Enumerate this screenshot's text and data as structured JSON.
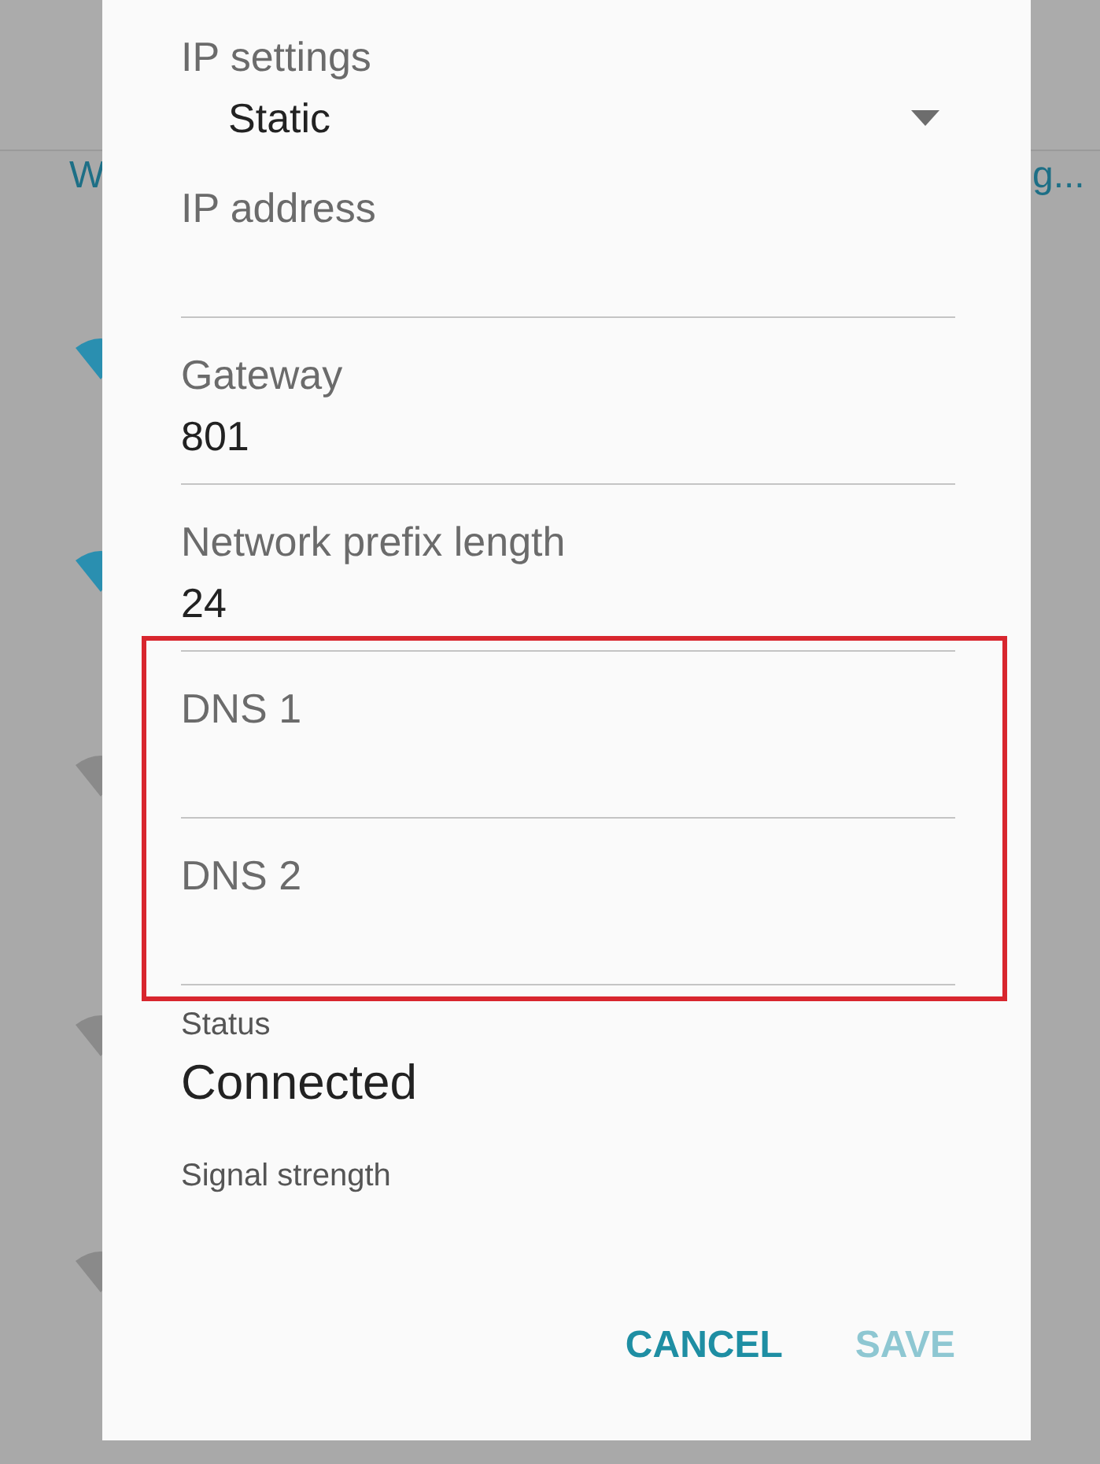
{
  "background": {
    "left_text": "W",
    "right_text": "g...",
    "wifi_icons": [
      {
        "color": "#2a8fb0"
      },
      {
        "color": "#2a8fb0"
      },
      {
        "color": "#8a8a8a"
      },
      {
        "color": "#8a8a8a"
      },
      {
        "color": "#8a8a8a"
      }
    ]
  },
  "dialog": {
    "fields": [
      {
        "kind": "dropdown",
        "label": "IP settings",
        "value": "Static",
        "highlighted": false
      },
      {
        "kind": "text",
        "label": "IP address",
        "highlighted": false
      },
      {
        "kind": "text",
        "label": "Gateway",
        "value": "801",
        "highlighted": false
      },
      {
        "kind": "text",
        "label": "Network prefix length",
        "value": "24",
        "highlighted": false
      },
      {
        "kind": "text",
        "label": "DNS 1",
        "highlighted": true
      },
      {
        "kind": "text",
        "label": "DNS 2",
        "highlighted": true
      },
      {
        "kind": "info",
        "label": "Status",
        "value": "Connected",
        "highlighted": false
      },
      {
        "kind": "info",
        "label": "Signal strength",
        "highlighted": false
      }
    ],
    "buttons": [
      {
        "label": "CANCEL",
        "disabled": false
      },
      {
        "label": "SAVE",
        "disabled": true
      }
    ]
  }
}
